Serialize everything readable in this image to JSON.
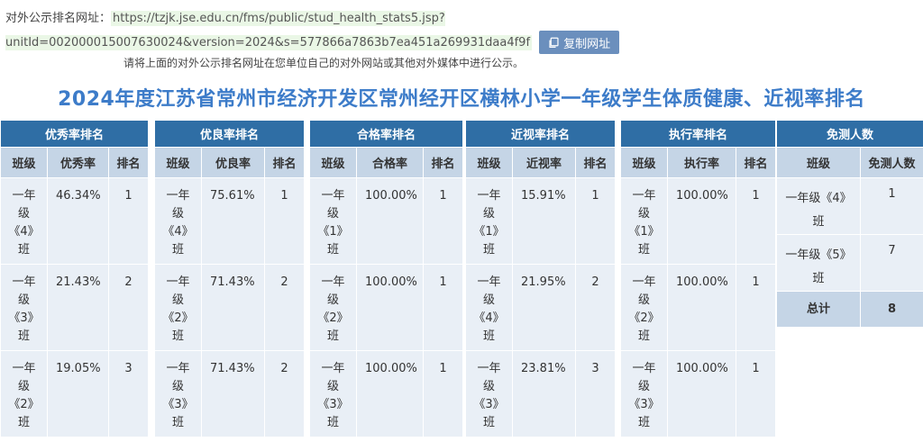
{
  "header": {
    "url_label": "对外公示排名网址：",
    "url": "https://tzjk.jse.edu.cn/fms/public/stud_health_stats5.jsp?unitId=002000015007630024&version=2024&s=577866a7863b7ea451a269931daa4f9f",
    "copy_button_label": "复制网址",
    "tip": "请将上面的对外公示排名网址在您单位自己的对外网站或其他对外媒体中进行公示。"
  },
  "title": "2024年度江苏省常州市经济开发区常州经开区横林小学一年级学生体质健康、近视率排名",
  "rankings": [
    {
      "caption": "优秀率排名",
      "columns": [
        "班级",
        "优秀率",
        "排名"
      ],
      "rows": [
        {
          "cls": "一年级《4》班",
          "value": "46.34%",
          "rank": "1"
        },
        {
          "cls": "一年级《3》班",
          "value": "21.43%",
          "rank": "2"
        },
        {
          "cls": "一年级《2》班",
          "value": "19.05%",
          "rank": "3"
        }
      ]
    },
    {
      "caption": "优良率排名",
      "columns": [
        "班级",
        "优良率",
        "排名"
      ],
      "rows": [
        {
          "cls": "一年级《4》班",
          "value": "75.61%",
          "rank": "1"
        },
        {
          "cls": "一年级《2》班",
          "value": "71.43%",
          "rank": "2"
        },
        {
          "cls": "一年级《3》班",
          "value": "71.43%",
          "rank": "2"
        }
      ]
    },
    {
      "caption": "合格率排名",
      "columns": [
        "班级",
        "合格率",
        "排名"
      ],
      "rows": [
        {
          "cls": "一年级《1》班",
          "value": "100.00%",
          "rank": "1"
        },
        {
          "cls": "一年级《2》班",
          "value": "100.00%",
          "rank": "1"
        },
        {
          "cls": "一年级《3》班",
          "value": "100.00%",
          "rank": "1"
        }
      ]
    },
    {
      "caption": "近视率排名",
      "columns": [
        "班级",
        "近视率",
        "排名"
      ],
      "rows": [
        {
          "cls": "一年级《1》班",
          "value": "15.91%",
          "rank": "1"
        },
        {
          "cls": "一年级《4》班",
          "value": "21.95%",
          "rank": "2"
        },
        {
          "cls": "一年级《3》班",
          "value": "23.81%",
          "rank": "3"
        }
      ]
    },
    {
      "caption": "执行率排名",
      "columns": [
        "班级",
        "执行率",
        "排名"
      ],
      "rows": [
        {
          "cls": "一年级《1》班",
          "value": "100.00%",
          "rank": "1"
        },
        {
          "cls": "一年级《2》班",
          "value": "100.00%",
          "rank": "1"
        },
        {
          "cls": "一年级《3》班",
          "value": "100.00%",
          "rank": "1"
        }
      ]
    }
  ],
  "exempt": {
    "caption": "免测人数",
    "columns": [
      "班级",
      "免测人数"
    ],
    "rows": [
      {
        "cls": "一年级《4》班",
        "count": "1"
      },
      {
        "cls": "一年级《5》班",
        "count": "7"
      }
    ],
    "total_label": "总计",
    "total": "8"
  },
  "colors": {
    "title": "#3d7cc9",
    "caption_bg": "#2f6ea5",
    "header_bg": "#c5d5e6",
    "cell_bg": "#e9eff6",
    "button_bg": "#6b8fbd",
    "url_highlight": "#eaf7e6"
  },
  "icons": {
    "copy_button": "copy-icon"
  }
}
